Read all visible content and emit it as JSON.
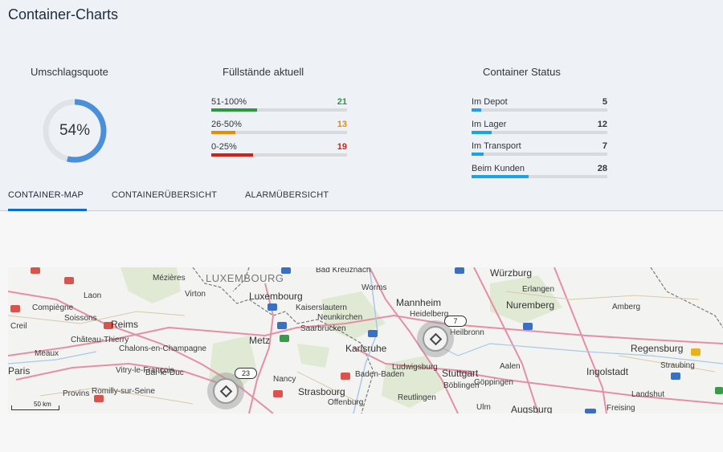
{
  "page": {
    "title": "Container-Charts"
  },
  "kpis": {
    "umschlag": {
      "title": "Umschlagsquote",
      "value_label": "54%",
      "value": 0.54,
      "color": "#4a90d9"
    },
    "fuellstand": {
      "title": "Füllstände aktuell",
      "rows": [
        {
          "label": "51-100%",
          "count": "21",
          "fill_fraction": 0.34,
          "color": "#2b9a3c"
        },
        {
          "label": "26-50%",
          "count": "13",
          "fill_fraction": 0.18,
          "color": "#e78c07"
        },
        {
          "label": "0-25%",
          "count": "19",
          "fill_fraction": 0.31,
          "color": "#d91e18"
        }
      ]
    },
    "status": {
      "title": "Container Status",
      "rows": [
        {
          "label": "Im Depot",
          "count": "5",
          "fill_fraction": 0.07,
          "color": "#1ba3e6"
        },
        {
          "label": "Im Lager",
          "count": "12",
          "fill_fraction": 0.15,
          "color": "#1ba3e6"
        },
        {
          "label": "Im Transport",
          "count": "7",
          "fill_fraction": 0.09,
          "color": "#1ba3e6"
        },
        {
          "label": "Beim Kunden",
          "count": "28",
          "fill_fraction": 0.42,
          "color": "#1ba3e6"
        }
      ]
    }
  },
  "tabs": [
    {
      "label": "CONTAINER-MAP",
      "active": true
    },
    {
      "label": "CONTAINERÜBERSICHT",
      "active": false
    },
    {
      "label": "ALARMÜBERSICHT",
      "active": false
    }
  ],
  "map": {
    "regions": [
      "LUXEMBOURG"
    ],
    "cities": [
      "Compiègne",
      "Laon",
      "Mézières",
      "Virton",
      "Soissons",
      "Reims",
      "Creil",
      "Château-Thierry",
      "Meaux",
      "Paris",
      "Chalons-en-Champagne",
      "Vitry-le-François",
      "Bar-le-Duc",
      "Provins",
      "Romilly-sur-Seine",
      "Luxembourg",
      "Metz",
      "Nancy",
      "Strasbourg",
      "Offenburg",
      "Saarbrucken",
      "Kaiserslautern",
      "Neunkirchen",
      "Worms",
      "Bad Kreuznach",
      "Mannheim",
      "Heidelberg",
      "Heilbronn",
      "Karlsruhe",
      "Baden-Baden",
      "Ludwigsburg",
      "Stuttgart",
      "Böblingen",
      "Göppingen",
      "Reutlingen",
      "Ulm",
      "Augsburg",
      "Aalen",
      "Würzburg",
      "Erlangen",
      "Nuremberg",
      "Amberg",
      "Regensburg",
      "Straubing",
      "Ingolstadt",
      "Landshut",
      "Freising"
    ],
    "clusters": [
      {
        "count": "7"
      },
      {
        "count": "23"
      }
    ],
    "scale": "50 km"
  }
}
